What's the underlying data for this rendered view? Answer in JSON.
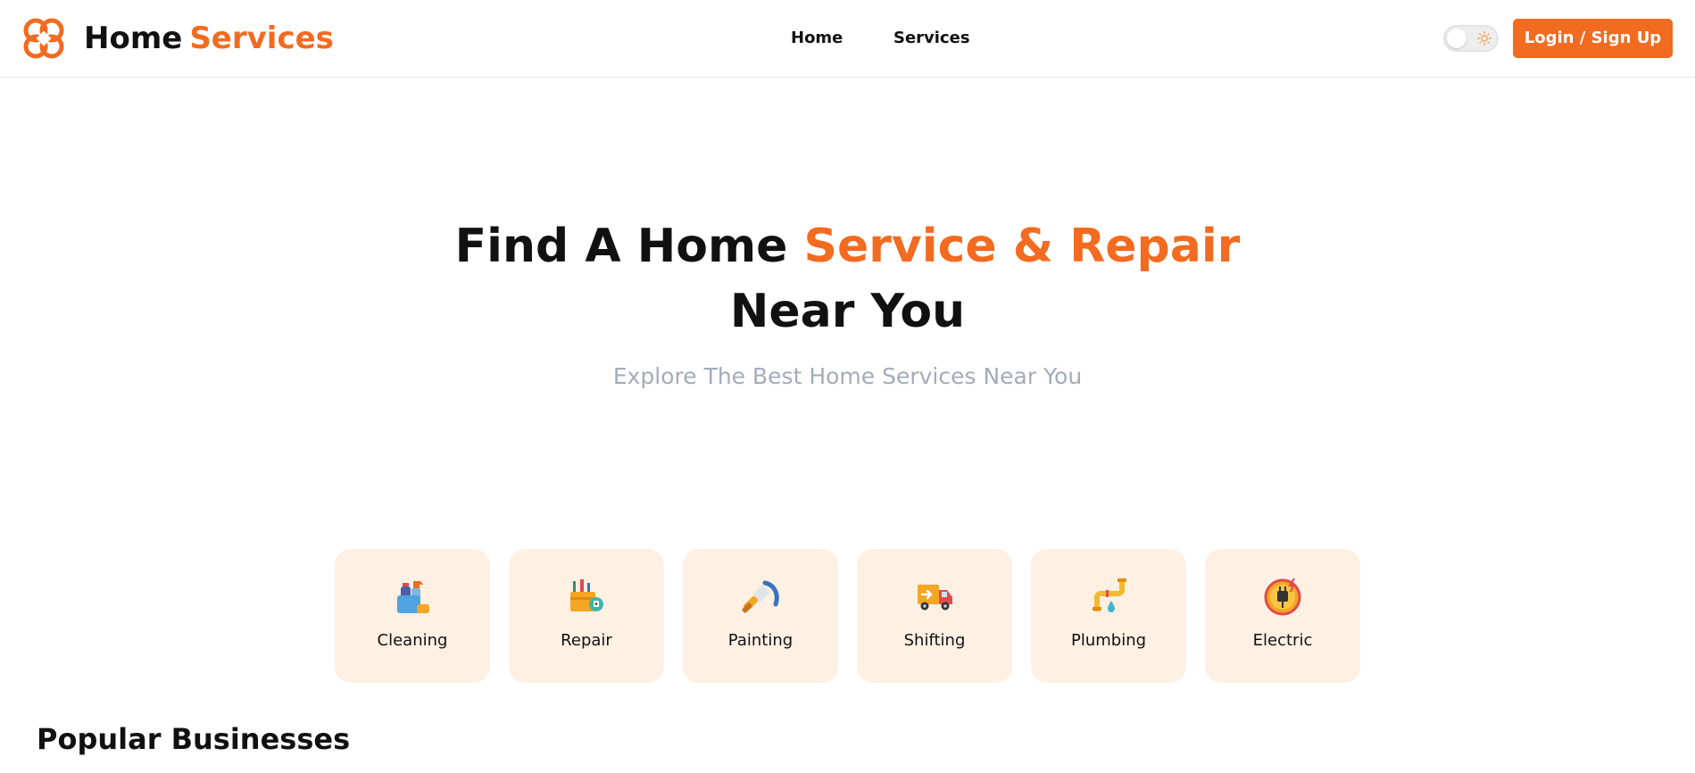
{
  "header": {
    "brand_part1": "Home",
    "brand_part2": "Services",
    "nav": [
      {
        "label": "Home"
      },
      {
        "label": "Services"
      }
    ],
    "login_label": "Login / Sign Up",
    "theme_toggle_icon": "sun-icon"
  },
  "hero": {
    "title_part1": "Find A Home",
    "title_highlight": "Service & Repair",
    "title_line2": "Near You",
    "subtitle": "Explore The Best Home Services Near You"
  },
  "categories": [
    {
      "label": "Cleaning",
      "icon": "cleaning-supplies-icon"
    },
    {
      "label": "Repair",
      "icon": "toolbox-icon"
    },
    {
      "label": "Painting",
      "icon": "paint-brush-icon"
    },
    {
      "label": "Shifting",
      "icon": "moving-truck-icon"
    },
    {
      "label": "Plumbing",
      "icon": "leaking-pipe-icon"
    },
    {
      "label": "Electric",
      "icon": "electric-plug-icon"
    }
  ],
  "popular": {
    "title": "Popular Businesses"
  },
  "colors": {
    "accent": "#f26b21",
    "card_bg": "#fff0e4",
    "subtitle": "#a3acba"
  }
}
